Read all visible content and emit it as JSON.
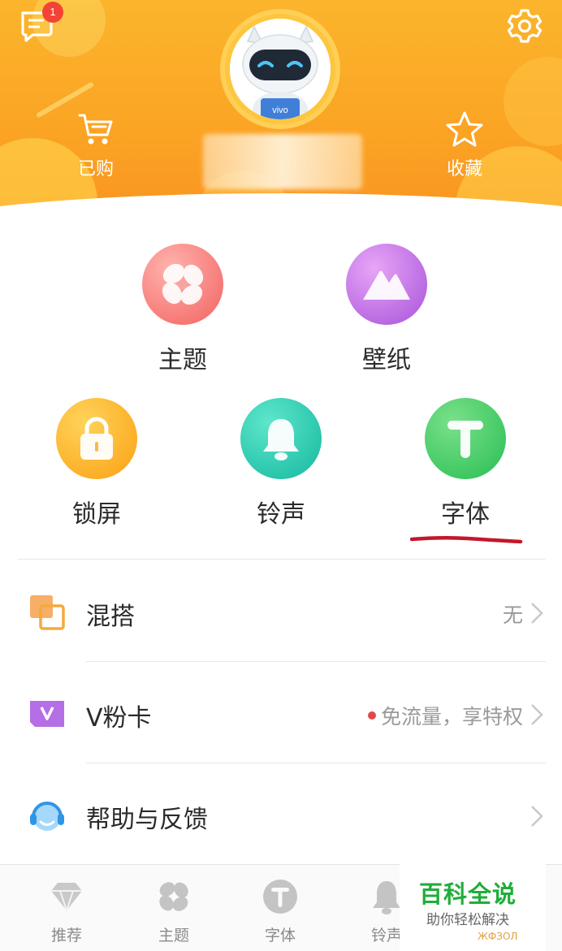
{
  "header": {
    "message_badge": "1",
    "bought_label": "已购",
    "favorites_label": "收藏",
    "avatar_brand": "vivo"
  },
  "categories": {
    "theme": "主题",
    "wallpaper": "壁纸",
    "lockscreen": "锁屏",
    "ringtone": "铃声",
    "font": "字体"
  },
  "list": {
    "mix": {
      "title": "混搭",
      "value": "无"
    },
    "vcard": {
      "title": "V粉卡",
      "value": "免流量，享特权"
    },
    "help": {
      "title": "帮助与反馈"
    }
  },
  "bottom_nav": {
    "recommend": "推荐",
    "theme": "主题",
    "font": "字体",
    "ringtone": "铃声"
  },
  "watermark": {
    "title": "百科全说",
    "subtitle": "助你轻松解决",
    "tail": "ЖФЗОЛ"
  },
  "colors": {
    "header_orange": "#fba324",
    "theme_red": "#f5726f",
    "wallpaper_purple": "#b463e0",
    "lock_yellow": "#fba81d",
    "ring_teal": "#1fbfa6",
    "font_green": "#34c35b",
    "annotation_red": "#c4162a",
    "watermark_green": "#1fae3a"
  },
  "icons": {
    "message": "message-icon",
    "settings": "gear-icon",
    "cart": "cart-icon",
    "star": "star-icon",
    "pinwheel": "pinwheel-icon",
    "mountain": "mountain-icon",
    "lock": "lock-icon",
    "bell": "bell-icon",
    "font": "font-t-icon",
    "mix": "overlap-squares-icon",
    "vcard": "v-card-icon",
    "help": "headset-icon",
    "diamond": "diamond-icon"
  }
}
